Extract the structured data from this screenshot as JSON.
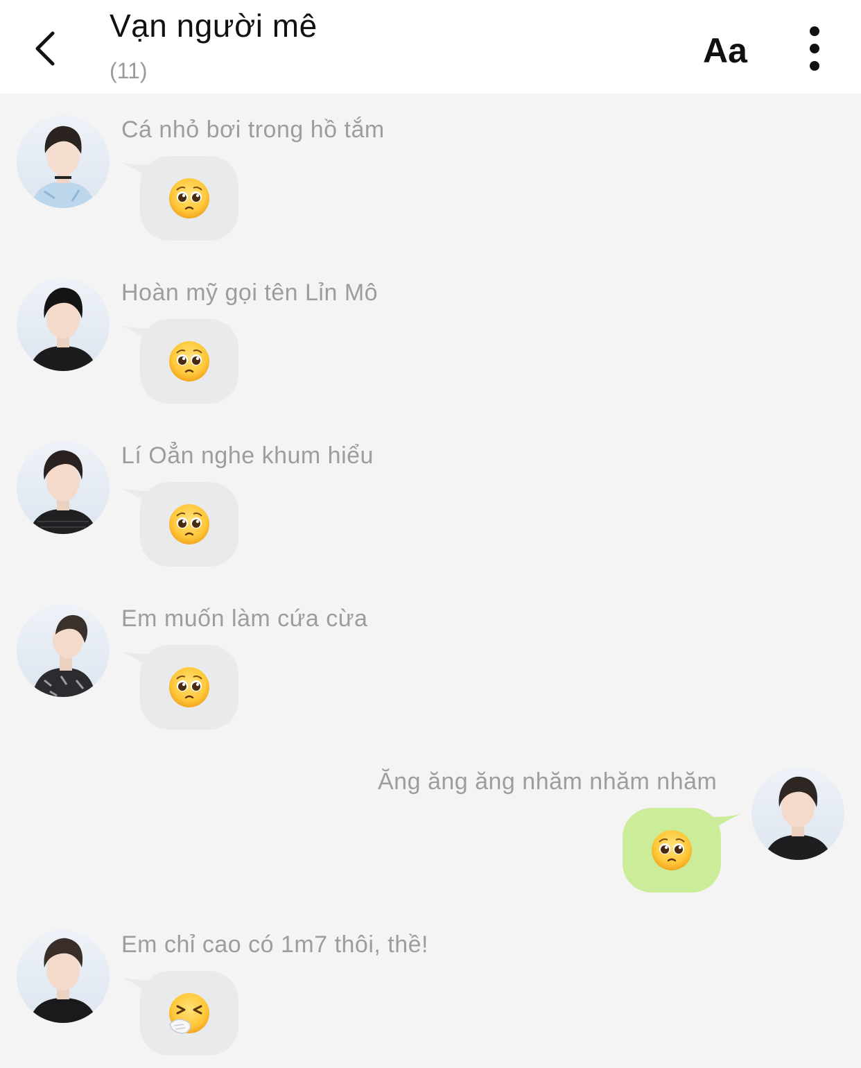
{
  "header": {
    "title": "Vạn người mê",
    "member_count": "(11)",
    "font_button_label": "Aa"
  },
  "colors": {
    "background": "#f4f4f4",
    "header_background": "#ffffff",
    "incoming_bubble": "#e9eaeb",
    "outgoing_bubble": "#cbec98",
    "name_text": "#9d9d9d"
  },
  "messages": [
    {
      "sender": "Cá nhỏ bơi trong hồ tắm",
      "direction": "incoming",
      "content_icon": "pleading-face-emoji"
    },
    {
      "sender": "Hoàn mỹ gọi tên Lỉn Mô",
      "direction": "incoming",
      "content_icon": "pleading-face-emoji"
    },
    {
      "sender": "Lí Oẳn nghe khum hiểu",
      "direction": "incoming",
      "content_icon": "pleading-face-emoji"
    },
    {
      "sender": "Em muốn làm cứa cừa",
      "direction": "incoming",
      "content_icon": "pleading-face-emoji"
    },
    {
      "sender": "Ăng ăng ăng nhăm nhăm nhăm",
      "direction": "outgoing",
      "content_icon": "pleading-face-emoji"
    },
    {
      "sender": "Em chỉ cao có 1m7 thôi, thề!",
      "direction": "incoming",
      "content_icon": "sneezing-face-emoji"
    }
  ]
}
